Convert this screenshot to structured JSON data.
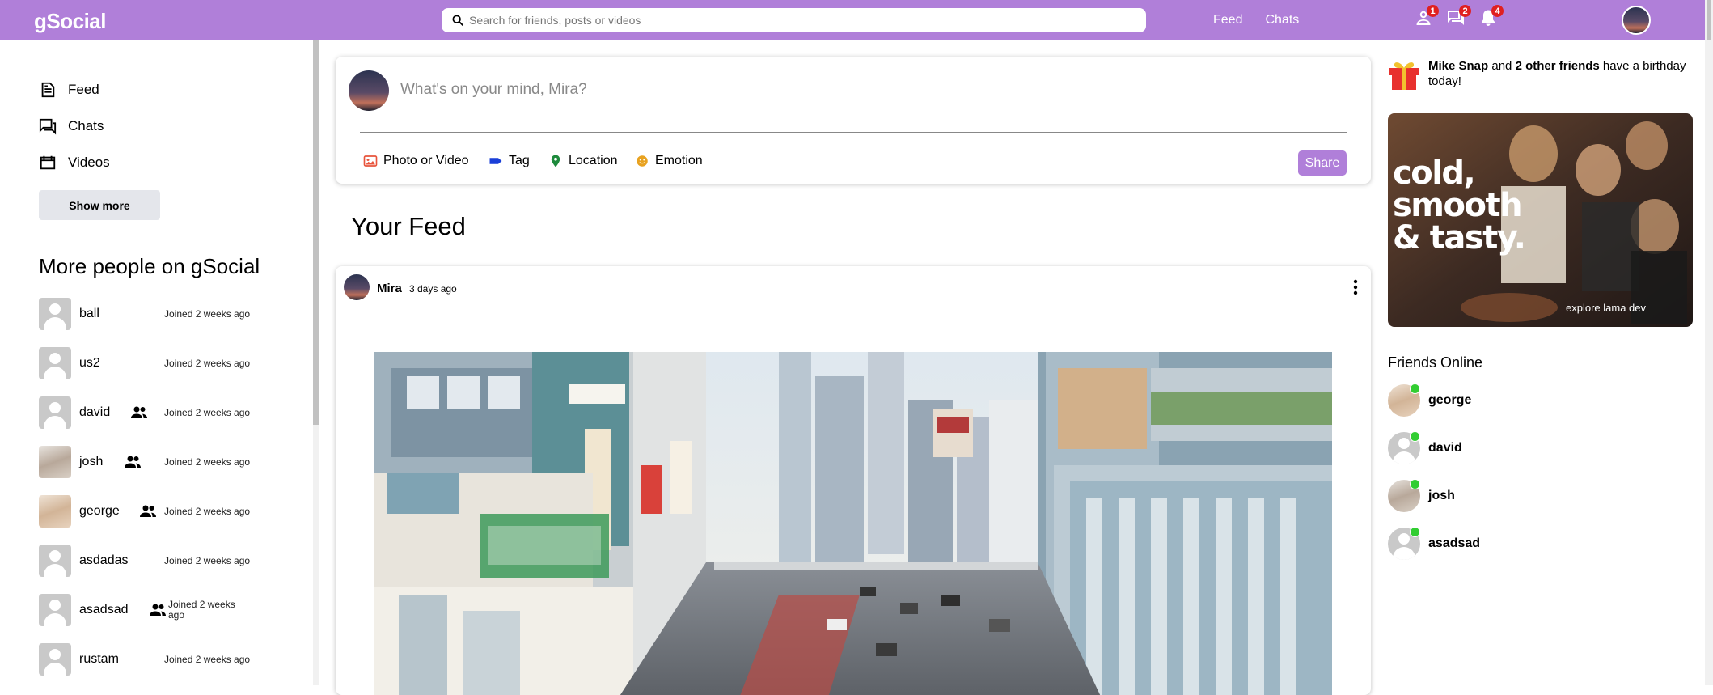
{
  "topbar": {
    "logo": "gSocial",
    "search_placeholder": "Search for friends, posts or videos",
    "links": [
      "Feed",
      "Chats"
    ],
    "badges": {
      "friends": "1",
      "messages": "2",
      "notifications": "4"
    }
  },
  "sidebar": {
    "items": [
      {
        "label": "Feed",
        "icon": "feed-icon"
      },
      {
        "label": "Chats",
        "icon": "chats-icon"
      },
      {
        "label": "Videos",
        "icon": "videos-icon"
      }
    ],
    "show_more": "Show more",
    "people_title": "More people on gSocial",
    "people": [
      {
        "name": "ball",
        "joined": "Joined 2 weeks ago",
        "friend": false
      },
      {
        "name": "us2",
        "joined": "Joined 2 weeks ago",
        "friend": false
      },
      {
        "name": "david",
        "joined": "Joined 2 weeks ago",
        "friend": true
      },
      {
        "name": "josh",
        "joined": "Joined 2 weeks ago",
        "friend": true
      },
      {
        "name": "george",
        "joined": "Joined 2 weeks ago",
        "friend": true
      },
      {
        "name": "asdadas",
        "joined": "Joined 2 weeks ago",
        "friend": false
      },
      {
        "name": "asadsad",
        "joined": "Joined 2 weeks ago",
        "friend": true
      },
      {
        "name": "rustam",
        "joined": "Joined 2 weeks ago",
        "friend": false
      }
    ]
  },
  "composer": {
    "placeholder": "What's on your mind, Mira?",
    "options": [
      "Photo or Video",
      "Tag",
      "Location",
      "Emotion"
    ],
    "share": "Share"
  },
  "feed": {
    "title": "Your Feed",
    "post": {
      "user": "Mira",
      "time": "3 days ago"
    }
  },
  "right": {
    "birthday": {
      "name": "Mike Snap",
      "mid": " and ",
      "others": "2 other friends",
      "suffix": " have a birthday today!"
    },
    "ad": {
      "headline_1": "cold,",
      "headline_2": "smooth",
      "headline_3": "& tasty.",
      "footer": "explore lama dev"
    },
    "friends_title": "Friends Online",
    "friends": [
      "george",
      "david",
      "josh",
      "asadsad"
    ]
  },
  "colors": {
    "brand": "#b07fd9",
    "badge": "#e02020",
    "online": "#32cd32"
  }
}
